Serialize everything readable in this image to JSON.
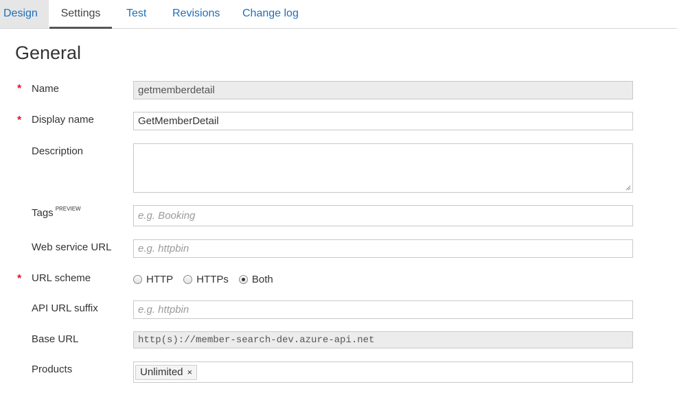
{
  "tabs": {
    "design": "Design",
    "settings": "Settings",
    "test": "Test",
    "revisions": "Revisions",
    "changelog": "Change log"
  },
  "section_title": "General",
  "required_marker": "*",
  "fields": {
    "name": {
      "label": "Name",
      "value": "getmemberdetail"
    },
    "display_name": {
      "label": "Display name",
      "value": "GetMemberDetail"
    },
    "description": {
      "label": "Description",
      "value": ""
    },
    "tags": {
      "label": "Tags",
      "badge": "PREVIEW",
      "placeholder": "e.g. Booking"
    },
    "web_service_url": {
      "label": "Web service URL",
      "placeholder": "e.g. httpbin"
    },
    "url_scheme": {
      "label": "URL scheme",
      "options": [
        "HTTP",
        "HTTPs",
        "Both"
      ],
      "selected": "Both"
    },
    "api_url_suffix": {
      "label": "API URL suffix",
      "placeholder": "e.g. httpbin"
    },
    "base_url": {
      "label": "Base URL",
      "value": "http(s)://member-search-dev.azure-api.net"
    },
    "products": {
      "label": "Products",
      "chips": [
        "Unlimited"
      ],
      "remove_glyph": "×"
    }
  },
  "colors": {
    "accent": "#1d6fb8",
    "required": "#e81123",
    "active_tab_bg": "#e6e6e6",
    "readonly_bg": "#ececec"
  }
}
